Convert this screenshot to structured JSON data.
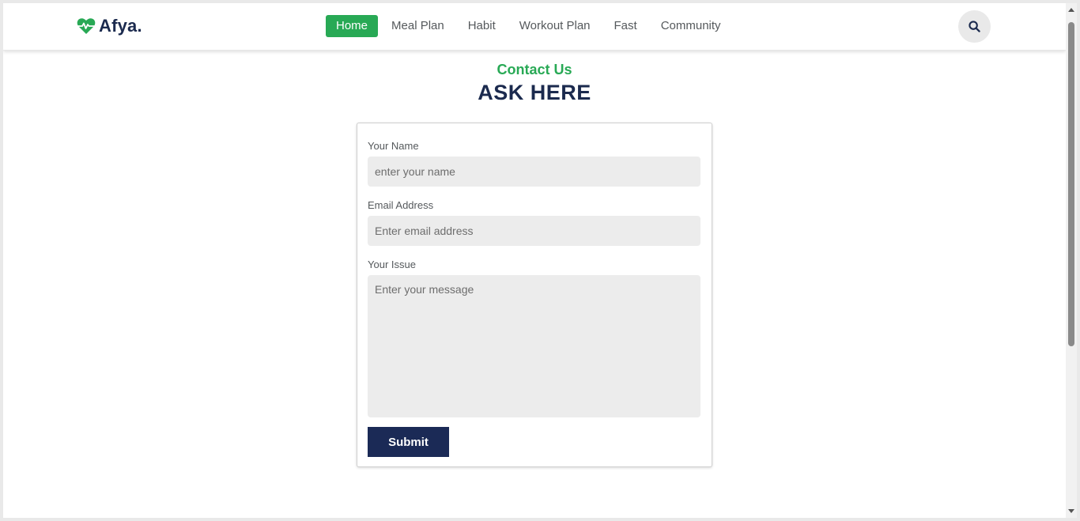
{
  "brand": {
    "name": "Afya.",
    "icon": "heartbeat-icon",
    "color": "#28a955"
  },
  "nav": {
    "items": [
      {
        "label": "Home",
        "active": true
      },
      {
        "label": "Meal Plan",
        "active": false
      },
      {
        "label": "Habit",
        "active": false
      },
      {
        "label": "Workout Plan",
        "active": false
      },
      {
        "label": "Fast",
        "active": false
      },
      {
        "label": "Community",
        "active": false
      }
    ],
    "search_icon": "search-icon"
  },
  "section": {
    "eyebrow": "Contact Us",
    "heading": "ASK HERE"
  },
  "form": {
    "name_label": "Your Name",
    "name_placeholder": "enter your name",
    "email_label": "Email Address",
    "email_placeholder": "Enter email address",
    "issue_label": "Your Issue",
    "issue_placeholder": "Enter your message",
    "submit_label": "Submit"
  },
  "colors": {
    "accent": "#28a955",
    "primary": "#1b2a56",
    "heading": "#1b2a4e"
  }
}
